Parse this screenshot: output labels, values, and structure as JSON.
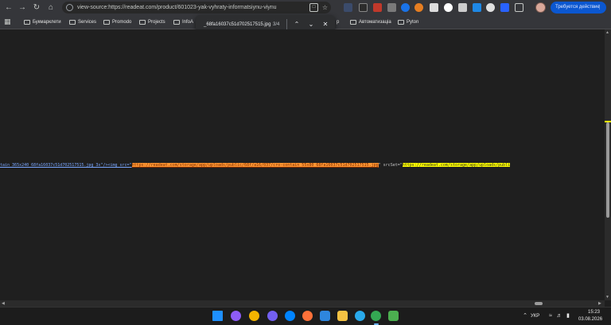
{
  "browser": {
    "url": "view-source:https://readeat.com/product/601023-yak-vyhraty-informatsiynu-viynu",
    "action_button": "Требуется действие"
  },
  "bookmarks": [
    {
      "label": "Букмарклети"
    },
    {
      "label": "Services"
    },
    {
      "label": "Promodo"
    },
    {
      "label": "Projects"
    },
    {
      "label": "InfoA"
    },
    {
      "label": "р"
    },
    {
      "label": "Автоматизаціа"
    },
    {
      "label": "Pyton"
    }
  ],
  "find": {
    "query": "_68fa16037c51d702517515.jpg",
    "count": "3/4"
  },
  "source": {
    "prefix": "tain_365x240_68fa16037c51d702517515.jpg 3x\"/><img src=\"",
    "current_match_url": "https://readeat.com/storage/app/uploads/public/68f/a16/037/cro-contain_55x80_68fa16037c51d702517515.jpg",
    "mid": "\" srcSet=\"",
    "other_match_url": "https://readeat.com/storage/app/uploads/publi"
  },
  "tray": {
    "language": "УКР",
    "time": "15:23",
    "date": "03.08.2026"
  },
  "colors": {
    "current_match": "#ff9632",
    "other_match": "#ffff00",
    "accent": "#0b57d0"
  },
  "icons": {
    "back": "arrow-left-icon",
    "forward": "arrow-right-icon",
    "reload": "reload-icon",
    "home": "home-icon",
    "bookmark_star": "star-icon",
    "find_prev": "chevron-up-icon",
    "find_next": "chevron-down-icon",
    "find_close": "close-icon"
  }
}
